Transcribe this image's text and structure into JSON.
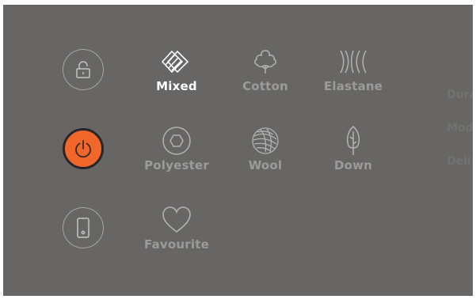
{
  "controls": {
    "lock": {
      "icon": "lock-icon"
    },
    "power": {
      "icon": "power-icon",
      "color": "#f0662b"
    },
    "remote": {
      "icon": "phone-icon"
    }
  },
  "fabrics": [
    {
      "label": "Mixed",
      "icon": "mixed-fabric-icon",
      "selected": true
    },
    {
      "label": "Cotton",
      "icon": "cotton-icon",
      "selected": false
    },
    {
      "label": "Elastane",
      "icon": "elastane-icon",
      "selected": false
    },
    {
      "label": "Polyester",
      "icon": "polyester-icon",
      "selected": false
    },
    {
      "label": "Wool",
      "icon": "wool-icon",
      "selected": false
    },
    {
      "label": "Down",
      "icon": "down-feather-icon",
      "selected": false
    },
    {
      "label": "Favourite",
      "icon": "heart-icon",
      "selected": false
    }
  ],
  "side_options": [
    "Dura",
    "Mod",
    "Deli"
  ],
  "colors": {
    "panel": "#676665",
    "accent": "#f0662b",
    "label": "#9c9b99",
    "selected_label": "#ffffff"
  }
}
